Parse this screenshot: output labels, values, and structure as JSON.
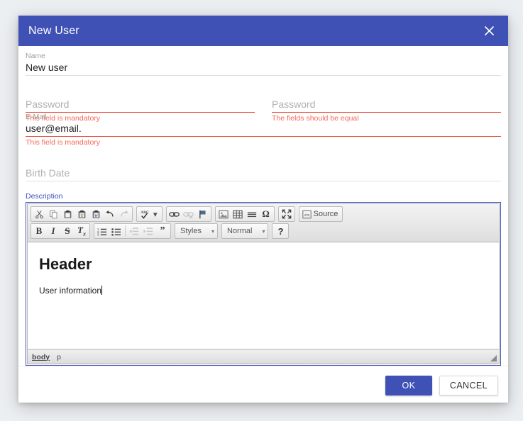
{
  "dialog": {
    "title": "New User",
    "close_icon": "close-icon"
  },
  "form": {
    "name": {
      "label": "Name",
      "value": "New user",
      "placeholder": ""
    },
    "password": {
      "label": "",
      "placeholder": "Password",
      "value": "",
      "error": "This field is mandatory"
    },
    "password_confirm": {
      "label": "",
      "placeholder": "Password",
      "value": "",
      "error": "The fields should be equal"
    },
    "email": {
      "label": "E-Mail",
      "value": "user@email.",
      "placeholder": "",
      "error": "This field is mandatory"
    },
    "birth_date": {
      "label": "",
      "placeholder": "Birth Date",
      "value": ""
    },
    "description": {
      "label": "Description"
    }
  },
  "editor": {
    "toolbar_row1": [
      {
        "name": "cut-icon",
        "title": "Cut",
        "group": 0,
        "disabled": false
      },
      {
        "name": "copy-icon",
        "title": "Copy",
        "group": 0,
        "disabled": false
      },
      {
        "name": "paste-icon",
        "title": "Paste",
        "group": 0,
        "disabled": false
      },
      {
        "name": "paste-text-icon",
        "title": "Paste as plain text",
        "group": 0,
        "disabled": false
      },
      {
        "name": "paste-word-icon",
        "title": "Paste from Word",
        "group": 0,
        "disabled": false
      },
      {
        "name": "undo-icon",
        "title": "Undo",
        "group": 0,
        "disabled": false
      },
      {
        "name": "redo-icon",
        "title": "Redo",
        "group": 0,
        "disabled": true
      },
      {
        "name": "spellcheck-icon",
        "title": "Spell Check As You Type",
        "group": 1,
        "disabled": false
      },
      {
        "name": "link-icon",
        "title": "Link",
        "group": 2,
        "disabled": false
      },
      {
        "name": "unlink-icon",
        "title": "Unlink",
        "group": 2,
        "disabled": true
      },
      {
        "name": "anchor-icon",
        "title": "Anchor",
        "group": 2,
        "disabled": false
      },
      {
        "name": "image-icon",
        "title": "Image",
        "group": 3,
        "disabled": false
      },
      {
        "name": "table-icon",
        "title": "Table",
        "group": 3,
        "disabled": false
      },
      {
        "name": "horizontal-rule-icon",
        "title": "Horizontal Line",
        "group": 3,
        "disabled": false
      },
      {
        "name": "special-char-icon",
        "title": "Insert Special Character",
        "group": 3,
        "disabled": false
      },
      {
        "name": "maximize-icon",
        "title": "Maximize",
        "group": 4,
        "disabled": false
      }
    ],
    "source_button": "Source",
    "toolbar_row2": [
      {
        "name": "bold-icon",
        "label": "B",
        "group": 0
      },
      {
        "name": "italic-icon",
        "label": "I",
        "group": 0
      },
      {
        "name": "strikethrough-icon",
        "label": "S",
        "group": 0
      },
      {
        "name": "remove-format-icon",
        "label": "Tx",
        "group": 0
      },
      {
        "name": "numbered-list-icon",
        "label": "",
        "group": 1
      },
      {
        "name": "bulleted-list-icon",
        "label": "",
        "group": 1
      },
      {
        "name": "outdent-icon",
        "label": "",
        "group": 1
      },
      {
        "name": "indent-icon",
        "label": "",
        "group": 1
      },
      {
        "name": "blockquote-icon",
        "label": "",
        "group": 1
      }
    ],
    "styles_combo": {
      "label": "Styles",
      "arrow": "▾"
    },
    "format_combo": {
      "label": "Normal",
      "arrow": "▾"
    },
    "help_button": "?",
    "content": {
      "heading": "Header",
      "paragraph": "User information"
    },
    "elements_path": [
      "body",
      "p"
    ]
  },
  "footer": {
    "ok_label": "OK",
    "cancel_label": "CANCEL"
  },
  "colors": {
    "header_blue": "#3f51b5",
    "error_red": "#f4695c",
    "error_underline": "#e8503a",
    "page_bg": "#eceff1"
  }
}
